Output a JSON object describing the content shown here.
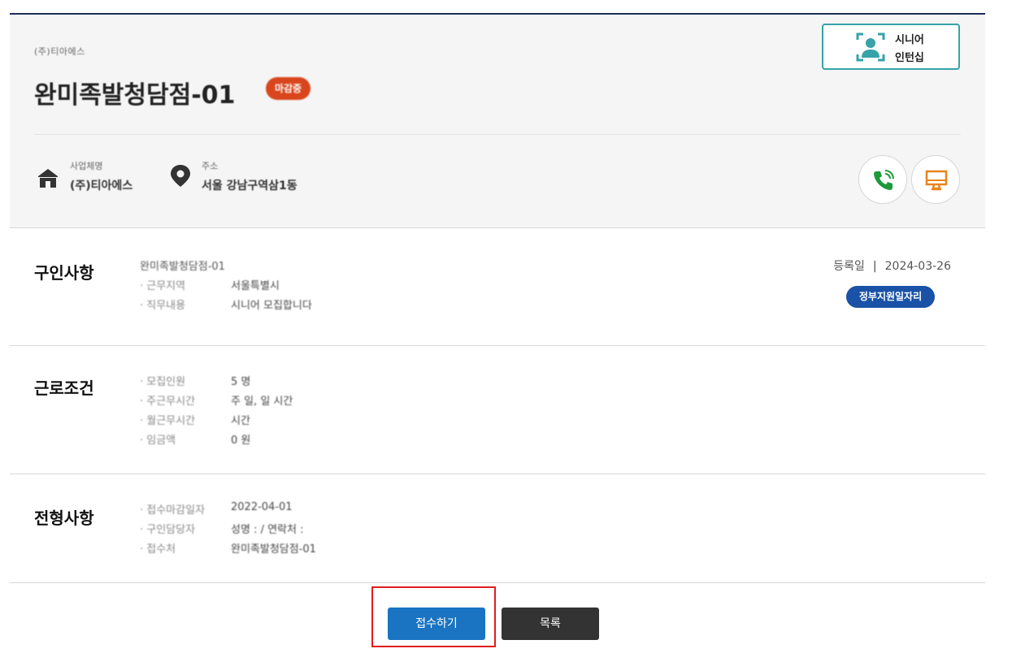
{
  "header": {
    "company_small": "(주)티아에스",
    "job_title": "완미족발청담점-01",
    "badge": "마감중",
    "senior_button": {
      "line1": "시니어",
      "line2": "인턴십"
    },
    "business_label": "사업체명",
    "business_value": "(주)티아에스",
    "address_label": "주소",
    "address_value": "서울 강남구역삼1동",
    "icons": {
      "phone": "phone-icon",
      "homepage": "monitor-icon",
      "business": "building-icon",
      "address": "location-pin-icon"
    }
  },
  "recruit": {
    "title": "구인사항",
    "intro": "완미족발청담점-01",
    "items": [
      {
        "k": "· 근무지역",
        "v": "서울특별시"
      },
      {
        "k": "· 직무내용",
        "v": "시니어 모집합니다"
      }
    ],
    "reg_label": "등록일",
    "reg_sep": "|",
    "reg_date": "2024-03-26",
    "gov_badge": "정부지원일자리"
  },
  "conditions": {
    "title": "근로조건",
    "items": [
      {
        "k": "· 모집인원",
        "v": "5 명"
      },
      {
        "k": "· 주근무시간",
        "v": "주 일, 일 시간"
      },
      {
        "k": "· 월근무시간",
        "v": "시간"
      },
      {
        "k": "· 임금액",
        "v": "0 원"
      }
    ]
  },
  "selection": {
    "title": "전형사항",
    "items": [
      {
        "k": "· 접수마감일자",
        "v": "2022-04-01"
      },
      {
        "k": "· 구인담당자",
        "v": "성명 : / 연락처 :"
      },
      {
        "k": "· 접수처",
        "v": "완미족발청담점-01"
      }
    ]
  },
  "actions": {
    "apply": "접수하기",
    "list": "목록"
  },
  "colors": {
    "primary": "#1a74c2",
    "navy_badge": "#1952a6",
    "teal": "#36a3a8",
    "badge_red": "#d9461d",
    "highlight": "#e11d1d"
  }
}
